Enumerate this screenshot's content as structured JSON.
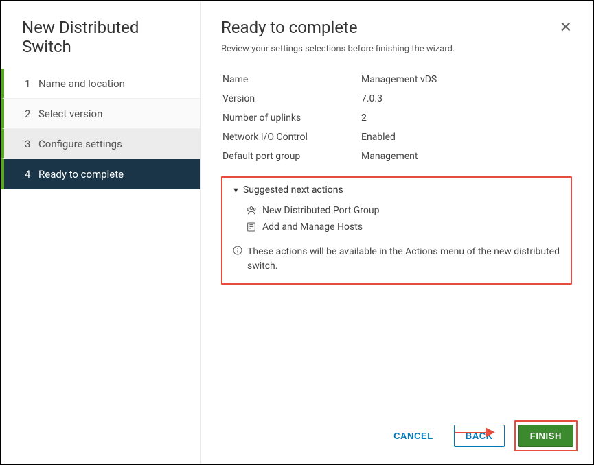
{
  "wizard": {
    "title": "New Distributed Switch",
    "steps": [
      {
        "num": "1",
        "label": "Name and location"
      },
      {
        "num": "2",
        "label": "Select version"
      },
      {
        "num": "3",
        "label": "Configure settings"
      },
      {
        "num": "4",
        "label": "Ready to complete"
      }
    ]
  },
  "page": {
    "title": "Ready to complete",
    "subtitle": "Review your settings selections before finishing the wizard."
  },
  "settings": {
    "name_label": "Name",
    "name_value": "Management vDS",
    "version_label": "Version",
    "version_value": "7.0.3",
    "uplinks_label": "Number of uplinks",
    "uplinks_value": "2",
    "nioc_label": "Network I/O Control",
    "nioc_value": "Enabled",
    "pg_label": "Default port group",
    "pg_value": "Management"
  },
  "suggested": {
    "header": "Suggested next actions",
    "action1": "New Distributed Port Group",
    "action2": "Add and Manage Hosts",
    "info": "These actions will be available in the Actions menu of the new distributed switch."
  },
  "buttons": {
    "cancel": "CANCEL",
    "back": "BACK",
    "finish": "FINISH"
  }
}
